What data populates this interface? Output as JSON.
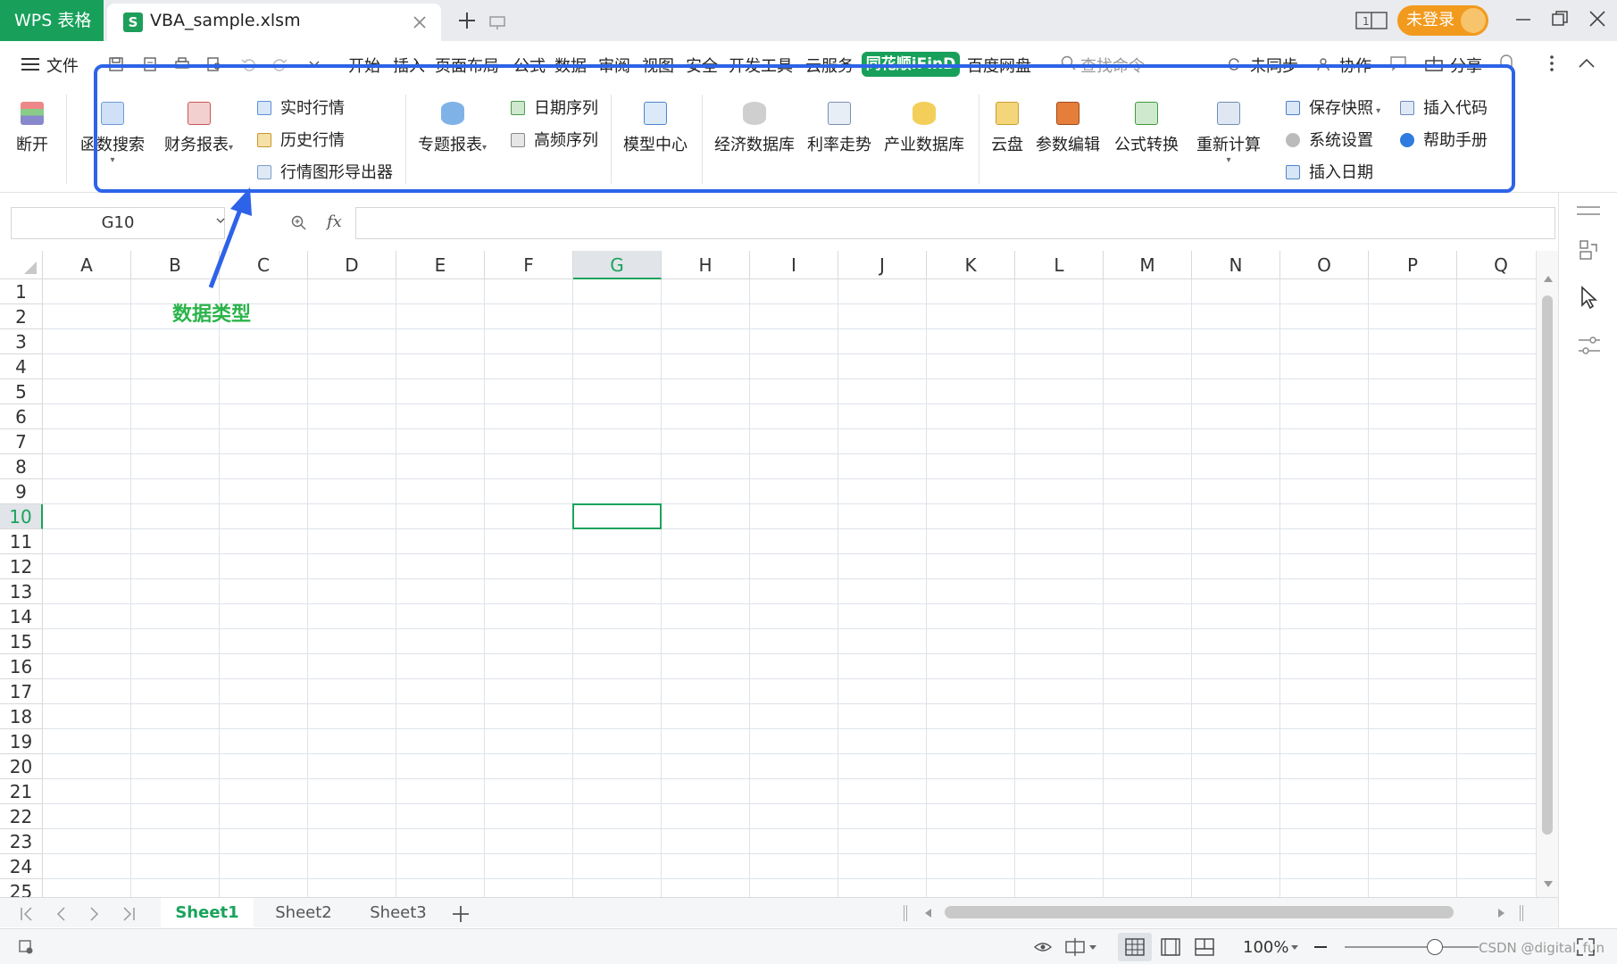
{
  "titlebar": {
    "app_tab": "WPS 表格",
    "file_tab": "VBA_sample.xlsm",
    "file_icon_letter": "S",
    "login_label": "未登录"
  },
  "menu": {
    "file_label": "文件",
    "items": [
      "开始",
      "插入",
      "页面布局",
      "公式",
      "数据",
      "审阅",
      "视图",
      "安全",
      "开发工具",
      "云服务"
    ],
    "active_tab": "同花顺iFinD",
    "after_active": "百度网盘",
    "search_placeholder": "查找命令",
    "sync_label": "未同步",
    "collab_label": "协作",
    "share_label": "分享"
  },
  "ribbon": {
    "disconnect": "断开",
    "func_search": "函数搜索",
    "finance_report": "财务报表",
    "realtime": "实时行情",
    "history": "历史行情",
    "chart_export": "行情图形导出器",
    "topic_report": "专题报表",
    "date_series": "日期序列",
    "hf_series": "高频序列",
    "model_center": "模型中心",
    "econ_db": "经济数据库",
    "rate_trend": "利率走势",
    "industry_db": "产业数据库",
    "cloud": "云盘",
    "param_edit": "参数编辑",
    "formula_convert": "公式转换",
    "recalc": "重新计算",
    "save_snapshot": "保存快照",
    "sys_settings": "系统设置",
    "insert_date": "插入日期",
    "insert_code": "插入代码",
    "help_manual": "帮助手册"
  },
  "formula": {
    "name_box": "G10",
    "fx": "fx"
  },
  "grid": {
    "columns": [
      "A",
      "B",
      "C",
      "D",
      "E",
      "F",
      "G",
      "H",
      "I",
      "J",
      "K",
      "L",
      "M",
      "N",
      "O",
      "P",
      "Q"
    ],
    "rows": [
      "1",
      "2",
      "3",
      "4",
      "5",
      "6",
      "7",
      "8",
      "9",
      "10",
      "11",
      "12",
      "13",
      "14",
      "15",
      "16",
      "17",
      "18",
      "19",
      "20",
      "21",
      "22",
      "23",
      "24",
      "25"
    ],
    "active_col": "G",
    "active_row": "10"
  },
  "annotation": {
    "text": "数据类型",
    "color": "#2bb44a",
    "box_color": "#2d63e8"
  },
  "sheets": {
    "tabs": [
      "Sheet1",
      "Sheet2",
      "Sheet3"
    ],
    "active": "Sheet1"
  },
  "status": {
    "zoom": "100%",
    "watermark": "CSDN @digital_fun"
  },
  "colors": {
    "brand_green": "#18a05b",
    "login_orange": "#f29a1e",
    "highlight_blue": "#2d63e8"
  }
}
